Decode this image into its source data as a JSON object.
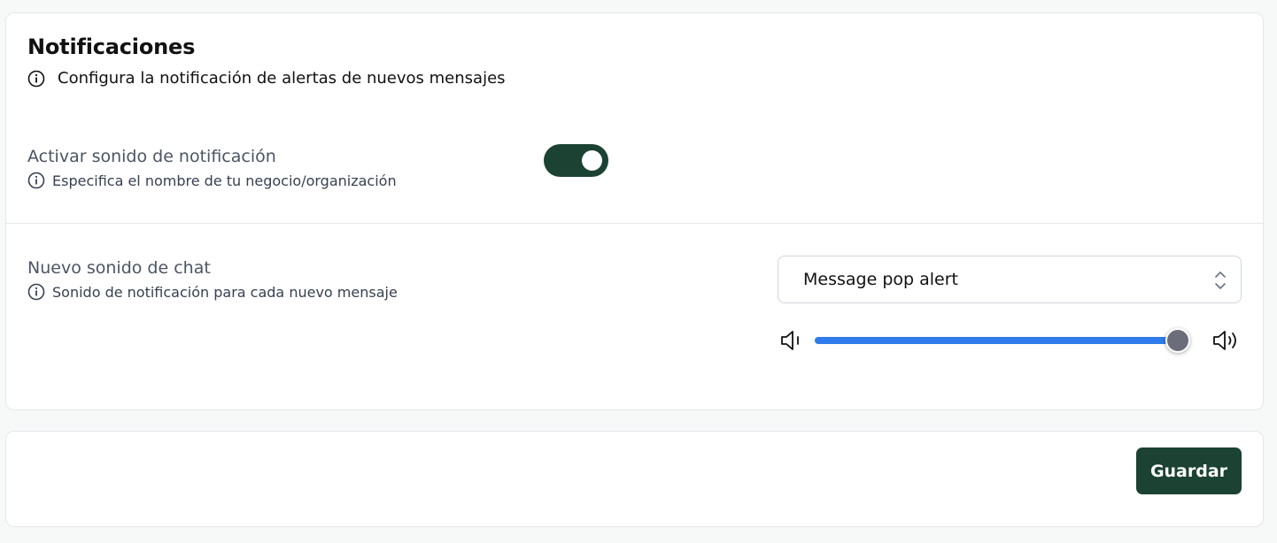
{
  "notifications": {
    "title": "Notificaciones",
    "subtitle": "Configura la notificación de alertas de nuevos mensajes",
    "sound_toggle": {
      "label": "Activar sonido de notificación",
      "help": "Especifica el nombre de tu negocio/organización",
      "enabled": true
    },
    "chat_sound": {
      "label": "Nuevo sonido de chat",
      "help": "Sonido de notificación para cada nuevo mensaje",
      "selected": "Message pop alert",
      "volume_percent": 100
    }
  },
  "footer": {
    "save_label": "Guardar"
  },
  "colors": {
    "brand": "#1b4233",
    "slider_fill": "#2f7bec"
  },
  "icons": [
    "info-icon",
    "chevron-updown-icon",
    "volume-low-icon",
    "volume-high-icon"
  ]
}
